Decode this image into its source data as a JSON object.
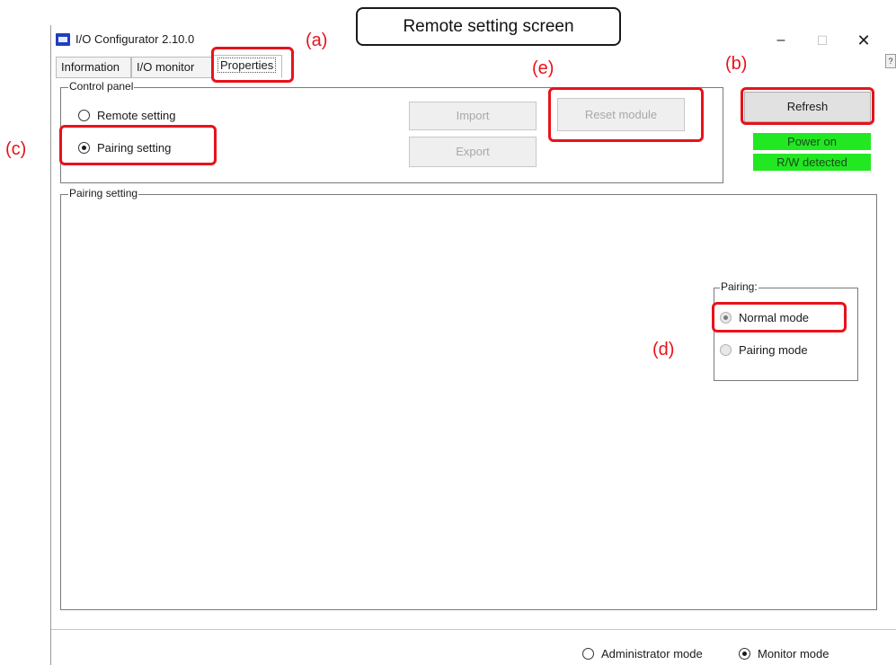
{
  "window": {
    "title": "I/O Configurator 2.10.0"
  },
  "window_controls": {
    "minimize": "–",
    "maximize": "☐",
    "close": "✕"
  },
  "help_tab": "?",
  "tabs": [
    {
      "label": "Information",
      "selected": false
    },
    {
      "label": "I/O monitor",
      "selected": false
    },
    {
      "label": "Properties",
      "selected": true
    }
  ],
  "control_panel": {
    "title": "Control panel",
    "radios": [
      {
        "label": "Remote setting",
        "checked": false
      },
      {
        "label": "Pairing setting",
        "checked": true
      }
    ],
    "import_label": "Import",
    "export_label": "Export",
    "reset_label": "Reset module"
  },
  "refresh_label": "Refresh",
  "status": {
    "power": "Power on",
    "rw": "R/W detected",
    "color": "#22e822"
  },
  "pairing_setting": {
    "title": "Pairing setting",
    "group_title": "Pairing:",
    "options": [
      {
        "label": "Normal mode",
        "checked": true
      },
      {
        "label": "Pairing mode",
        "checked": false
      }
    ]
  },
  "mode_bar": {
    "administrator": "Administrator mode",
    "monitor": "Monitor mode",
    "selected": "Monitor mode"
  },
  "annotations": {
    "callout": "Remote setting screen",
    "a": "(a)",
    "b": "(b)",
    "c": "(c)",
    "d": "(d)",
    "e": "(e)",
    "highlight_color": "#e8121b"
  }
}
